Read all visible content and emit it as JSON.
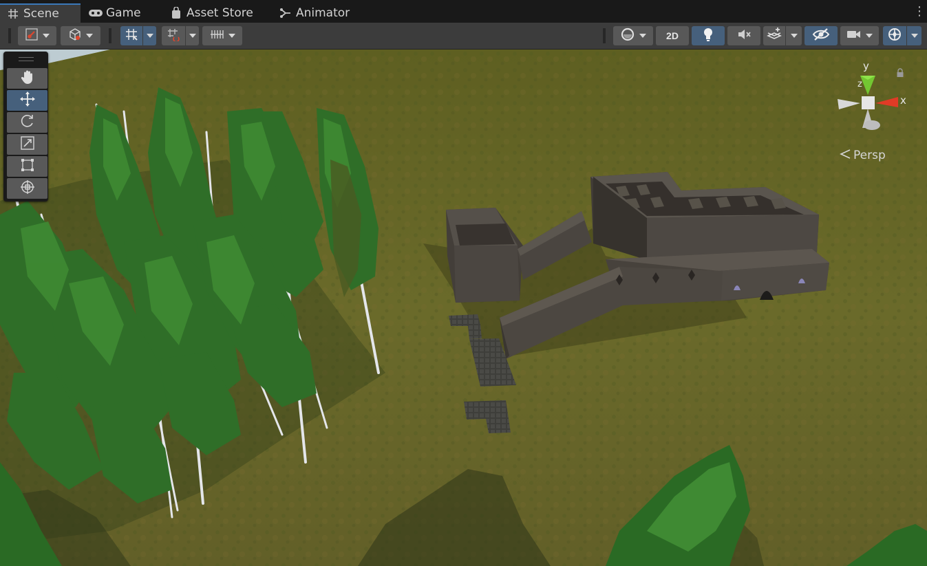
{
  "tabs": [
    {
      "label": "Scene",
      "icon": "hash-grid-icon",
      "active": true
    },
    {
      "label": "Game",
      "icon": "gamepad-icon",
      "active": false
    },
    {
      "label": "Asset Store",
      "icon": "shopping-bag-icon",
      "active": false
    },
    {
      "label": "Animator",
      "icon": "animator-icon",
      "active": false
    }
  ],
  "toolbar": {
    "left": [
      "draw-mode-icon",
      "render-cube-icon",
      "grid-snap-icon",
      "increment-snap-icon",
      "ruler-grid-icon"
    ],
    "right": [
      "shading-sphere-icon",
      "lightbulb-icon",
      "mute-audio-icon",
      "effects-icon",
      "hidden-visibility-icon",
      "camera-icon",
      "gizmos-icon"
    ],
    "btn_2d_label": "2D"
  },
  "tools": {
    "items": [
      "hand-tool-icon",
      "move-tool-icon",
      "rotate-tool-icon",
      "scale-tool-icon",
      "rect-tool-icon",
      "transform-tool-icon"
    ],
    "selected": "move-tool-icon"
  },
  "gizmo": {
    "y_label": "y",
    "x_label": "x",
    "z_label": "z",
    "projection_label": "Persp",
    "colors": {
      "x": "#e03b26",
      "y": "#73c632",
      "z": "#3a6fd8",
      "neutral": "#d6d6d6"
    }
  },
  "scene": {
    "ground_color": "#6a6a2a",
    "foliage_color": "#2f7a2f",
    "building_color": "#4a4540"
  }
}
